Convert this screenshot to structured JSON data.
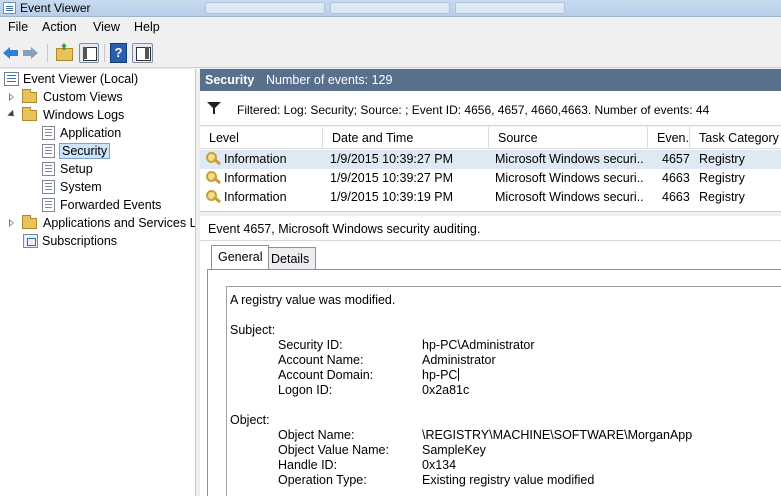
{
  "window": {
    "title": "Event Viewer"
  },
  "menu": {
    "file": "File",
    "action": "Action",
    "view": "View",
    "help": "Help"
  },
  "toolbar": {
    "help_glyph": "?"
  },
  "tree": {
    "root": "Event Viewer (Local)",
    "custom_views": "Custom Views",
    "windows_logs": "Windows Logs",
    "application": "Application",
    "security": "Security",
    "setup": "Setup",
    "system": "System",
    "forwarded_events": "Forwarded Events",
    "apps_services": "Applications and Services Lo",
    "subscriptions": "Subscriptions"
  },
  "log_header": {
    "name": "Security",
    "count_text": "Number of events: 129"
  },
  "filter": {
    "text": "Filtered: Log: Security; Source: ; Event ID: 4656, 4657, 4660,4663. Number of events: 44"
  },
  "grid": {
    "columns": [
      "Level",
      "Date and Time",
      "Source",
      "Even...",
      "Task Category"
    ],
    "rows": [
      {
        "level": "Information",
        "datetime": "1/9/2015 10:39:27 PM",
        "source": "Microsoft Windows securi...",
        "event_id": "4657",
        "task": "Registry"
      },
      {
        "level": "Information",
        "datetime": "1/9/2015 10:39:27 PM",
        "source": "Microsoft Windows securi...",
        "event_id": "4663",
        "task": "Registry"
      },
      {
        "level": "Information",
        "datetime": "1/9/2015 10:39:19 PM",
        "source": "Microsoft Windows securi...",
        "event_id": "4663",
        "task": "Registry"
      }
    ]
  },
  "detail": {
    "title": "Event 4657, Microsoft Windows security auditing.",
    "tabs": {
      "general": "General",
      "details": "Details"
    },
    "summary": "A registry value was modified.",
    "subject": {
      "heading": "Subject:",
      "security_id_label": "Security ID:",
      "security_id": "hp-PC\\Administrator",
      "account_name_label": "Account Name:",
      "account_name": "Administrator",
      "account_domain_label": "Account Domain:",
      "account_domain": "hp-PC",
      "logon_id_label": "Logon ID:",
      "logon_id": "0x2a81c"
    },
    "object": {
      "heading": "Object:",
      "object_name_label": "Object Name:",
      "object_name": "\\REGISTRY\\MACHINE\\SOFTWARE\\MorganApp",
      "object_value_name_label": "Object Value Name:",
      "object_value_name": "SampleKey",
      "handle_id_label": "Handle ID:",
      "handle_id": "0x134",
      "operation_type_label": "Operation Type:",
      "operation_type": "Existing registry value modified"
    }
  }
}
